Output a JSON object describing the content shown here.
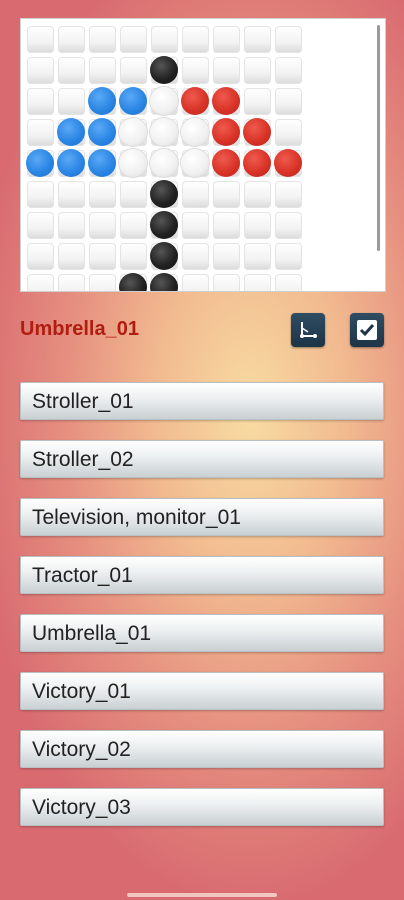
{
  "selected_title": "Umbrella_01",
  "toolbar": {
    "icon_left": "chart-axis-icon",
    "icon_right": "checkmark-icon"
  },
  "items": [
    {
      "label": "Stroller_01"
    },
    {
      "label": "Stroller_02"
    },
    {
      "label": "Television, monitor_01"
    },
    {
      "label": "Tractor_01"
    },
    {
      "label": "Umbrella_01"
    },
    {
      "label": "Victory_01"
    },
    {
      "label": "Victory_02"
    },
    {
      "label": "Victory_03"
    }
  ],
  "colors": {
    "title": "#b01e12",
    "blue_dot": "#2b86e4",
    "red_dot": "#d93327",
    "black_dot": "#222222"
  }
}
